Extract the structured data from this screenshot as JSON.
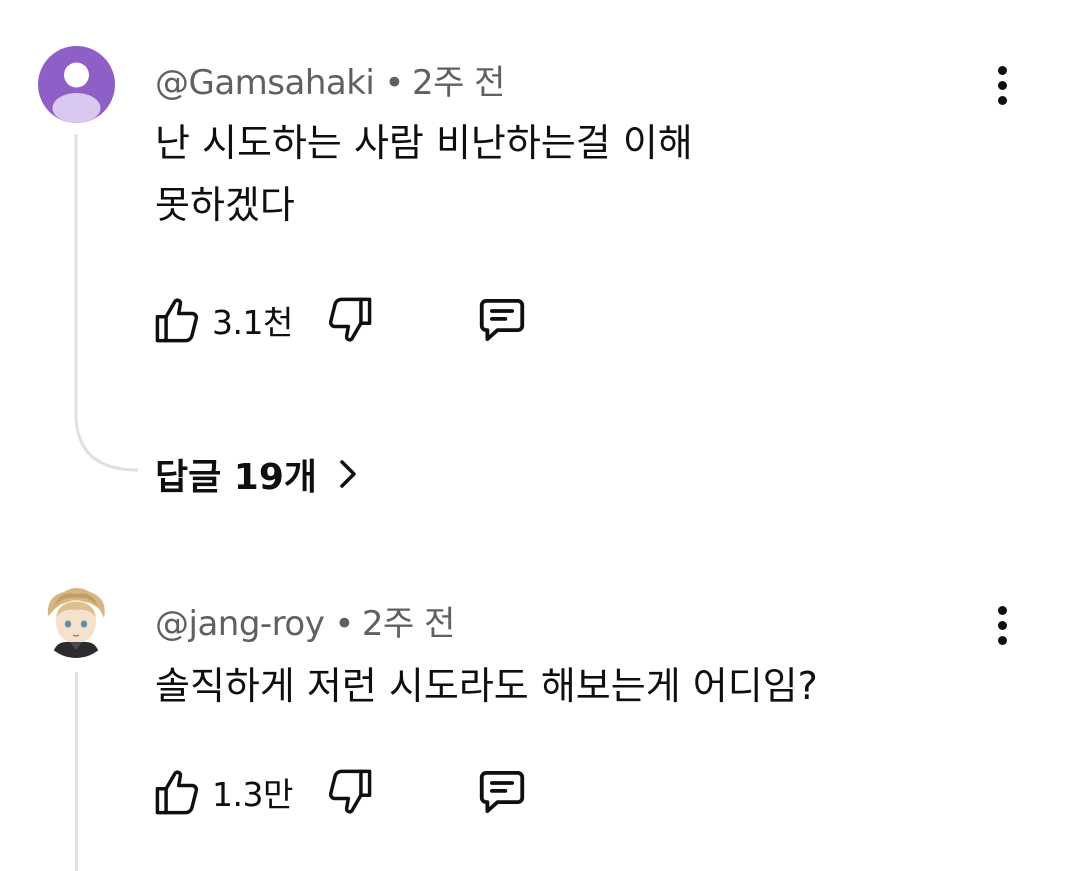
{
  "comments": [
    {
      "handle": "@Gamsahaki",
      "time": "2주 전",
      "text_line1": "난 시도하는 사람 비난하는걸 이해",
      "text_line2": "못하겠다",
      "likes": "3.1천",
      "replies_label": "답글 19개",
      "avatar_color": "#8e5fc6"
    },
    {
      "handle": "@jang-roy",
      "time": "2주 전",
      "text_line1": "솔직하게 저런 시도라도 해보는게 어디임?",
      "likes": "1.3만"
    }
  ],
  "separator": "•",
  "icons": {
    "like": "thumbs-up-icon",
    "dislike": "thumbs-down-icon",
    "reply": "comment-icon",
    "menu": "more-vertical-icon",
    "replies_chevron": "chevron-right-icon"
  }
}
